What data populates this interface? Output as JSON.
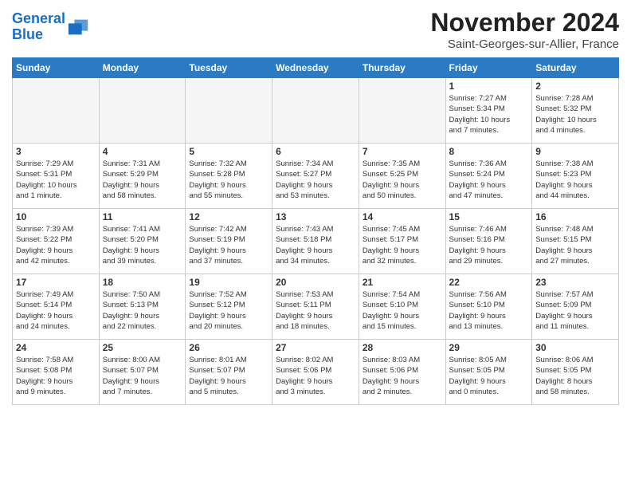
{
  "header": {
    "logo_line1": "General",
    "logo_line2": "Blue",
    "month": "November 2024",
    "location": "Saint-Georges-sur-Allier, France"
  },
  "weekdays": [
    "Sunday",
    "Monday",
    "Tuesday",
    "Wednesday",
    "Thursday",
    "Friday",
    "Saturday"
  ],
  "weeks": [
    [
      {
        "day": "",
        "info": "",
        "empty": true
      },
      {
        "day": "",
        "info": "",
        "empty": true
      },
      {
        "day": "",
        "info": "",
        "empty": true
      },
      {
        "day": "",
        "info": "",
        "empty": true
      },
      {
        "day": "",
        "info": "",
        "empty": true
      },
      {
        "day": "1",
        "info": "Sunrise: 7:27 AM\nSunset: 5:34 PM\nDaylight: 10 hours\nand 7 minutes.",
        "empty": false
      },
      {
        "day": "2",
        "info": "Sunrise: 7:28 AM\nSunset: 5:32 PM\nDaylight: 10 hours\nand 4 minutes.",
        "empty": false
      }
    ],
    [
      {
        "day": "3",
        "info": "Sunrise: 7:29 AM\nSunset: 5:31 PM\nDaylight: 10 hours\nand 1 minute.",
        "empty": false
      },
      {
        "day": "4",
        "info": "Sunrise: 7:31 AM\nSunset: 5:29 PM\nDaylight: 9 hours\nand 58 minutes.",
        "empty": false
      },
      {
        "day": "5",
        "info": "Sunrise: 7:32 AM\nSunset: 5:28 PM\nDaylight: 9 hours\nand 55 minutes.",
        "empty": false
      },
      {
        "day": "6",
        "info": "Sunrise: 7:34 AM\nSunset: 5:27 PM\nDaylight: 9 hours\nand 53 minutes.",
        "empty": false
      },
      {
        "day": "7",
        "info": "Sunrise: 7:35 AM\nSunset: 5:25 PM\nDaylight: 9 hours\nand 50 minutes.",
        "empty": false
      },
      {
        "day": "8",
        "info": "Sunrise: 7:36 AM\nSunset: 5:24 PM\nDaylight: 9 hours\nand 47 minutes.",
        "empty": false
      },
      {
        "day": "9",
        "info": "Sunrise: 7:38 AM\nSunset: 5:23 PM\nDaylight: 9 hours\nand 44 minutes.",
        "empty": false
      }
    ],
    [
      {
        "day": "10",
        "info": "Sunrise: 7:39 AM\nSunset: 5:22 PM\nDaylight: 9 hours\nand 42 minutes.",
        "empty": false
      },
      {
        "day": "11",
        "info": "Sunrise: 7:41 AM\nSunset: 5:20 PM\nDaylight: 9 hours\nand 39 minutes.",
        "empty": false
      },
      {
        "day": "12",
        "info": "Sunrise: 7:42 AM\nSunset: 5:19 PM\nDaylight: 9 hours\nand 37 minutes.",
        "empty": false
      },
      {
        "day": "13",
        "info": "Sunrise: 7:43 AM\nSunset: 5:18 PM\nDaylight: 9 hours\nand 34 minutes.",
        "empty": false
      },
      {
        "day": "14",
        "info": "Sunrise: 7:45 AM\nSunset: 5:17 PM\nDaylight: 9 hours\nand 32 minutes.",
        "empty": false
      },
      {
        "day": "15",
        "info": "Sunrise: 7:46 AM\nSunset: 5:16 PM\nDaylight: 9 hours\nand 29 minutes.",
        "empty": false
      },
      {
        "day": "16",
        "info": "Sunrise: 7:48 AM\nSunset: 5:15 PM\nDaylight: 9 hours\nand 27 minutes.",
        "empty": false
      }
    ],
    [
      {
        "day": "17",
        "info": "Sunrise: 7:49 AM\nSunset: 5:14 PM\nDaylight: 9 hours\nand 24 minutes.",
        "empty": false
      },
      {
        "day": "18",
        "info": "Sunrise: 7:50 AM\nSunset: 5:13 PM\nDaylight: 9 hours\nand 22 minutes.",
        "empty": false
      },
      {
        "day": "19",
        "info": "Sunrise: 7:52 AM\nSunset: 5:12 PM\nDaylight: 9 hours\nand 20 minutes.",
        "empty": false
      },
      {
        "day": "20",
        "info": "Sunrise: 7:53 AM\nSunset: 5:11 PM\nDaylight: 9 hours\nand 18 minutes.",
        "empty": false
      },
      {
        "day": "21",
        "info": "Sunrise: 7:54 AM\nSunset: 5:10 PM\nDaylight: 9 hours\nand 15 minutes.",
        "empty": false
      },
      {
        "day": "22",
        "info": "Sunrise: 7:56 AM\nSunset: 5:10 PM\nDaylight: 9 hours\nand 13 minutes.",
        "empty": false
      },
      {
        "day": "23",
        "info": "Sunrise: 7:57 AM\nSunset: 5:09 PM\nDaylight: 9 hours\nand 11 minutes.",
        "empty": false
      }
    ],
    [
      {
        "day": "24",
        "info": "Sunrise: 7:58 AM\nSunset: 5:08 PM\nDaylight: 9 hours\nand 9 minutes.",
        "empty": false
      },
      {
        "day": "25",
        "info": "Sunrise: 8:00 AM\nSunset: 5:07 PM\nDaylight: 9 hours\nand 7 minutes.",
        "empty": false
      },
      {
        "day": "26",
        "info": "Sunrise: 8:01 AM\nSunset: 5:07 PM\nDaylight: 9 hours\nand 5 minutes.",
        "empty": false
      },
      {
        "day": "27",
        "info": "Sunrise: 8:02 AM\nSunset: 5:06 PM\nDaylight: 9 hours\nand 3 minutes.",
        "empty": false
      },
      {
        "day": "28",
        "info": "Sunrise: 8:03 AM\nSunset: 5:06 PM\nDaylight: 9 hours\nand 2 minutes.",
        "empty": false
      },
      {
        "day": "29",
        "info": "Sunrise: 8:05 AM\nSunset: 5:05 PM\nDaylight: 9 hours\nand 0 minutes.",
        "empty": false
      },
      {
        "day": "30",
        "info": "Sunrise: 8:06 AM\nSunset: 5:05 PM\nDaylight: 8 hours\nand 58 minutes.",
        "empty": false
      }
    ]
  ]
}
